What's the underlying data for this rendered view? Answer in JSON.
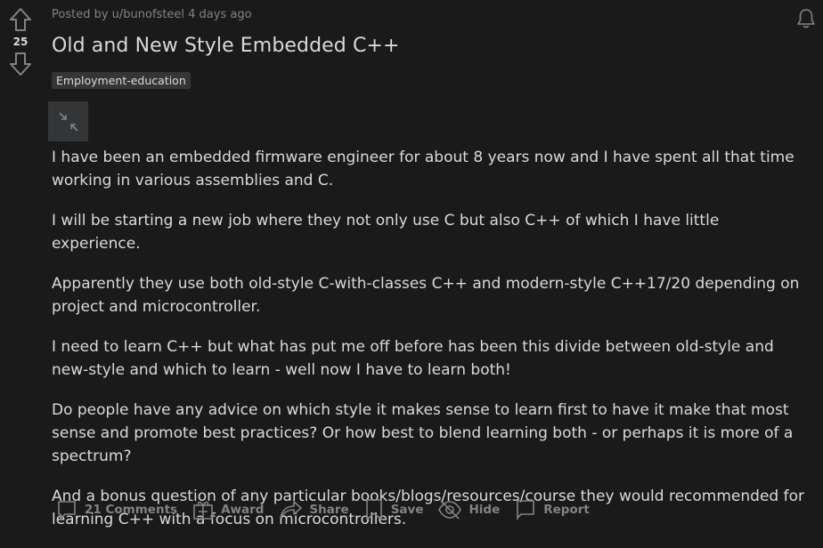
{
  "post": {
    "score": "25",
    "meta": "Posted by u/bunofsteel 4 days ago",
    "title": "Old and New Style Embedded C++",
    "flair": "Employment-education",
    "paragraphs": [
      "I have been an embedded firmware engineer for about 8 years now and I have spent all that time working in various assemblies and C.",
      "I will be starting a new job where they not only use C but also C++ of which I have little experience.",
      "Apparently they use both old-style C-with-classes C++ and modern-style C++17/20 depending on project and microcontroller.",
      "I need to learn C++ but what has put me off before has been this divide between old-style and new-style and which to learn - well now I have to learn both!",
      "Do people have any advice on which style it makes sense to learn first to have it make that most sense and promote best practices? Or how best to blend learning both - or perhaps it is more of a spectrum?",
      "And a bonus question of any particular books/blogs/resources/course they would recommended for learning C++ with a focus on microcontrollers."
    ]
  },
  "actions": {
    "comments": "21 Comments",
    "award": "Award",
    "share": "Share",
    "save": "Save",
    "hide": "Hide",
    "report": "Report"
  },
  "icons": {
    "upvote": "arrow-up-icon",
    "downvote": "arrow-down-icon",
    "collapse": "collapse-icon",
    "notifications": "bell-icon",
    "comments": "comment-icon",
    "award": "gift-icon",
    "share": "share-arrow-icon",
    "save": "bookmark-icon",
    "hide": "eye-slash-icon",
    "report": "flag-icon"
  },
  "colors": {
    "background": "#1a1a1b",
    "text": "#d7dadc",
    "muted": "#818384",
    "flair_bg": "#343536"
  }
}
